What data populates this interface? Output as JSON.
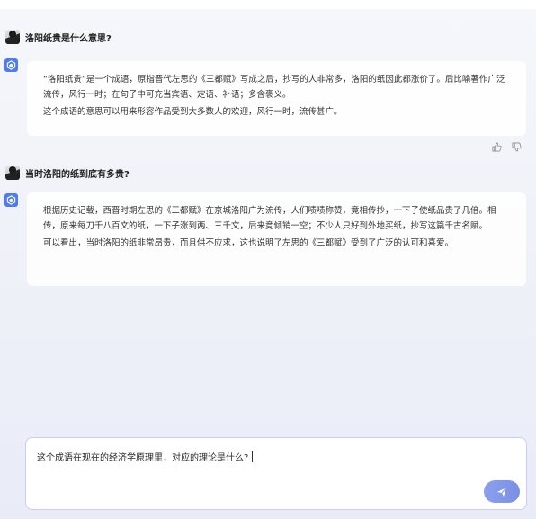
{
  "conversation": [
    {
      "question": "洛阳纸贵是什么意思?",
      "answer": [
        "“洛阳纸贵”是一个成语，原指晋代左思的《三都赋》写成之后，抄写的人非常多，洛阳的纸因此都涨价了。后比喻著作广泛流传，风行一时；在句子中可充当宾语、定语、补语；多含褒义。",
        "这个成语的意思可以用来形容作品受到大多数人的欢迎，风行一时，流传甚广。"
      ]
    },
    {
      "question": "当时洛阳的纸到底有多贵?",
      "answer": [
        "根据历史记载，西晋时期左思的《三都赋》在京城洛阳广为流传，人们啧啧称赞，竟相传抄，一下子使纸品贵了几倍。相传，原来每刀千八百文的纸，一下子涨到两、三千文，后来竟倾销一空；不少人只好到外地买纸，抄写这篇千古名赋。",
        "可以看出，当时洛阳的纸非常昂贵，而且供不应求，这也说明了左思的《三都赋》受到了广泛的认可和喜爱。"
      ]
    }
  ],
  "composer": {
    "value": "这个成语在现在的经济学原理里，对应的理论是什么?"
  },
  "icons": {
    "user_avatar": "user-avatar",
    "bot": "cube-logo-icon",
    "like": "thumbs-up-icon",
    "dislike": "thumbs-down-icon",
    "send": "send-arrow-icon"
  },
  "colors": {
    "accent": "#4d7cf0",
    "send_button": "#7f93e9",
    "input_border": "#c9cef0"
  }
}
